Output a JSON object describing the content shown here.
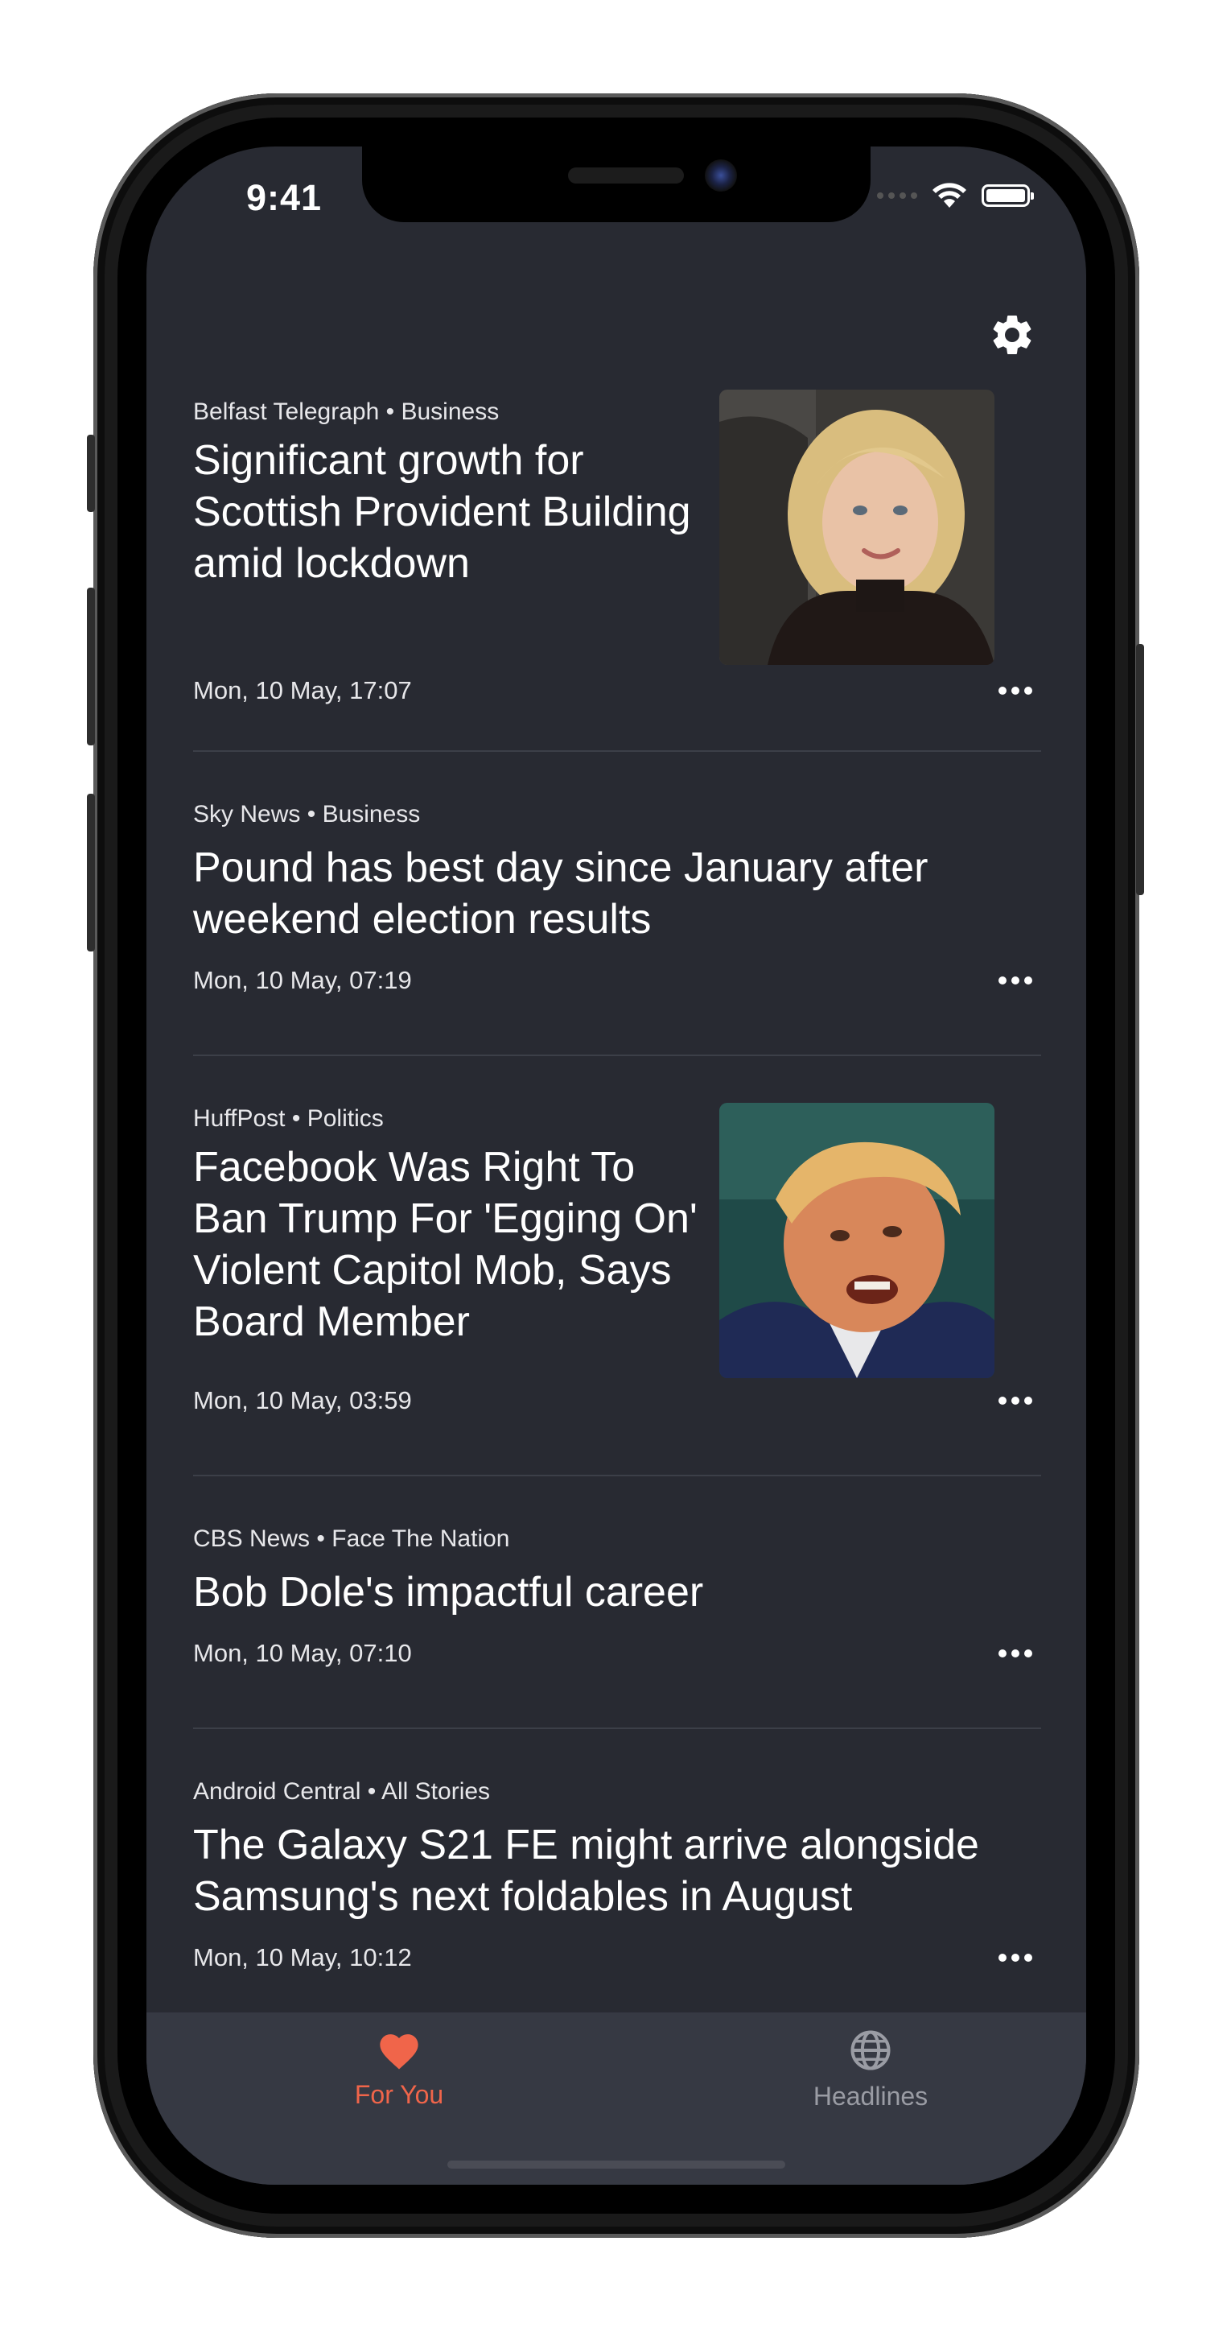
{
  "status_bar": {
    "time": "9:41"
  },
  "toolbar": {
    "settings_icon": "gear-icon"
  },
  "articles": [
    {
      "source": "Belfast Telegraph",
      "section": "Business",
      "title": "Significant growth for Scottish Provident Building amid lockdown",
      "date": "Mon, 10 May, 17:07",
      "has_image": true
    },
    {
      "source": "Sky News",
      "section": "Business",
      "title": "Pound has best day since January after weekend election results",
      "date": "Mon, 10 May, 07:19",
      "has_image": false
    },
    {
      "source": "HuffPost",
      "section": "Politics",
      "title": "Facebook Was Right To Ban Trump For 'Egging On' Violent Capitol Mob, Says Board Member",
      "date": "Mon, 10 May, 03:59",
      "has_image": true
    },
    {
      "source": "CBS News",
      "section": "Face The Nation",
      "title": "Bob Dole's impactful career",
      "date": "Mon, 10 May, 07:10",
      "has_image": false
    },
    {
      "source": "Android Central",
      "section": "All Stories",
      "title": "The Galaxy S21 FE might arrive alongside Samsung's next foldables in August",
      "date": "Mon, 10 May, 10:12",
      "has_image": false
    }
  ],
  "meta_separator": "•",
  "tabs": [
    {
      "label": "For You",
      "icon": "heart-icon",
      "active": true
    },
    {
      "label": "Headlines",
      "icon": "globe-icon",
      "active": false
    }
  ],
  "colors": {
    "background": "#282a32",
    "tabbar": "#363943",
    "accent": "#f0654a",
    "inactive_tab": "#9a9ca4",
    "divider": "#3c3f48"
  }
}
